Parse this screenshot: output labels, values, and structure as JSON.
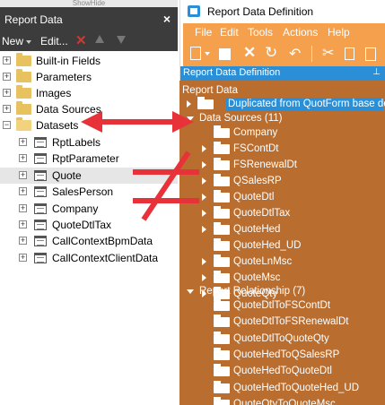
{
  "left_panel": {
    "top_strip": "ShowHide",
    "title": "Report Data",
    "close_glyph": "×",
    "toolbar": {
      "new_label": "New",
      "edit_label": "Edit...",
      "delete_icon": "delete-icon",
      "up_icon": "move-up-icon",
      "down_icon": "move-down-icon"
    },
    "tree": [
      {
        "label": "Built-in Fields",
        "expander": "+",
        "icon": "folder-icon"
      },
      {
        "label": "Parameters",
        "expander": "+",
        "icon": "folder-icon"
      },
      {
        "label": "Images",
        "expander": "+",
        "icon": "folder-icon"
      },
      {
        "label": "Data Sources",
        "expander": "+",
        "icon": "folder-icon"
      },
      {
        "label": "Datasets",
        "expander": "−",
        "icon": "folder-open-icon"
      }
    ],
    "datasets": [
      {
        "label": "RptLabels",
        "expander": "+"
      },
      {
        "label": "RptParameter",
        "expander": "+"
      },
      {
        "label": "Quote",
        "expander": "+",
        "selected": true
      },
      {
        "label": "SalesPerson",
        "expander": "+"
      },
      {
        "label": "Company",
        "expander": "+"
      },
      {
        "label": "QuoteDtlTax",
        "expander": "+"
      },
      {
        "label": "CallContextBpmData",
        "expander": "+"
      },
      {
        "label": "CallContextClientData",
        "expander": "+"
      }
    ]
  },
  "right_window": {
    "title": "Report Data Definition",
    "menu": [
      "File",
      "Edit",
      "Tools",
      "Actions",
      "Help"
    ],
    "panel_header": "Report Data Definition",
    "pin_glyph": "📌",
    "report_data_label": "Report Data",
    "duplicated_label": "Duplicated from QuotForm base def",
    "data_sources_label": "Data Sources (11)",
    "data_sources": [
      {
        "label": "Company",
        "expandable": false
      },
      {
        "label": "FSContDt",
        "expandable": true
      },
      {
        "label": "FSRenewalDt",
        "expandable": true
      },
      {
        "label": "QSalesRP",
        "expandable": true
      },
      {
        "label": "QuoteDtl",
        "expandable": true
      },
      {
        "label": "QuoteDtlTax",
        "expandable": true
      },
      {
        "label": "QuoteHed",
        "expandable": true
      },
      {
        "label": "QuoteHed_UD",
        "expandable": false
      },
      {
        "label": "QuoteLnMsc",
        "expandable": true
      },
      {
        "label": "QuoteMsc",
        "expandable": true
      },
      {
        "label": "QuoteQty",
        "expandable": true
      }
    ],
    "relationship_label": "Report Relationship (7)",
    "relationships": [
      "QuoteDtlToFSContDt",
      "QuoteDtlToFSRenewalDt",
      "QuoteDtlToQuoteQty",
      "QuoteHedToQSalesRP",
      "QuoteHedToQuoteDtl",
      "QuoteHedToQuoteHed_UD",
      "QuoteQtyToQuoteMsc"
    ]
  },
  "colors": {
    "dark_bar": "#3c3c3c",
    "orange_bar": "#f4a04d",
    "blue_header": "#2a8fd6",
    "tree_bg": "#b96e2f",
    "annotation_red": "#e8323a"
  }
}
